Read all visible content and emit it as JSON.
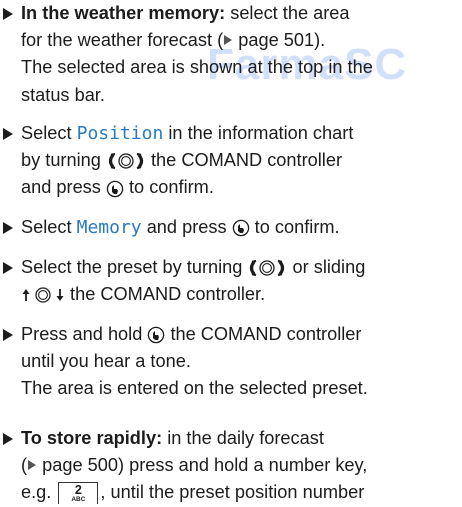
{
  "watermark": "FarmaSC",
  "steps": {
    "s1": {
      "heading": "In the weather memory:",
      "line1_rest": " select the area",
      "line2_a": "for the weather forecast (",
      "line2_ref": " page 501).",
      "line3": "The selected area is shown at the top in the",
      "line4": "status bar."
    },
    "s2": {
      "line1_a": "Select ",
      "line1_code": "Position",
      "line1_b": " in the information chart",
      "line2_a": "by turning ",
      "line2_b": " the COMAND controller",
      "line3_a": "and press ",
      "line3_b": " to confirm."
    },
    "s3": {
      "line1_a": "Select ",
      "line1_code": "Memory",
      "line1_b": " and press ",
      "line1_c": " to confirm."
    },
    "s4": {
      "line1_a": "Select the preset by turning ",
      "line1_b": " or sliding",
      "line2_b": " the COMAND controller."
    },
    "s5": {
      "line1_a": "Press and hold ",
      "line1_b": " the COMAND controller",
      "line2": "until you hear a tone.",
      "line3": "The area is entered on the selected preset."
    },
    "s6": {
      "heading": "To store rapidly:",
      "line1_rest": " in the daily forecast",
      "line2_a": "(",
      "line2_ref": " page 500) press and hold a number key,",
      "line3_a": "e.g. ",
      "key_num": "2",
      "key_sub": "ABC",
      "line3_b": ", until the preset position number"
    }
  },
  "icons": {
    "step_bullet": "right-triangle-bullet",
    "page_reference": "page-reference-triangle",
    "turn": "turn-controller-icon",
    "press": "press-controller-icon",
    "slide": "slide-controller-icon",
    "key": "number-key-icon"
  }
}
